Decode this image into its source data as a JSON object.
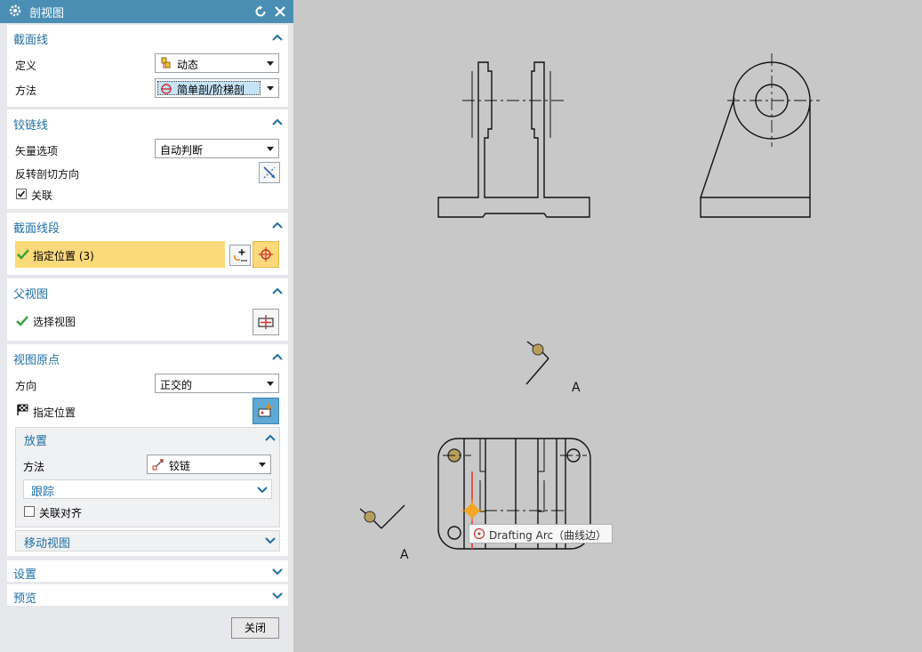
{
  "dialog": {
    "title": "剖视图",
    "close_button": "关闭"
  },
  "sections": {
    "section_line": {
      "title": "截面线",
      "definition_label": "定义",
      "definition_value": "动态",
      "method_label": "方法",
      "method_value": "简单剖/阶梯剖"
    },
    "hinge_line": {
      "title": "铰链线",
      "vector_label": "矢量选项",
      "vector_value": "自动判断",
      "reverse_label": "反转剖切方向",
      "associative_label": "关联",
      "associative_checked": true
    },
    "section_segment": {
      "title": "截面线段",
      "specify_label": "指定位置 (3)"
    },
    "parent_view": {
      "title": "父视图",
      "select_label": "选择视图"
    },
    "view_origin": {
      "title": "视图原点",
      "direction_label": "方向",
      "direction_value": "正交的",
      "specify_label": "指定位置",
      "placement": {
        "title": "放置",
        "method_label": "方法",
        "method_value": "铰链",
        "track_label": "跟踪",
        "align_label": "关联对齐",
        "align_checked": false
      },
      "move_view_label": "移动视图"
    },
    "settings": {
      "title": "设置"
    },
    "preview": {
      "title": "预览"
    }
  },
  "canvas": {
    "section_label_top": "A",
    "section_label_bottom": "A",
    "tooltip": "Drafting Arc（曲线边）"
  },
  "colors": {
    "title_bar": "#4a8fb3",
    "section_heading": "#1f6fa6",
    "highlight": "#fcd97a",
    "check_green": "#2fa33a",
    "cursor_orange": "#f5a623",
    "red_line": "#e0584a",
    "canvas_bg": "#c8c8c8"
  }
}
